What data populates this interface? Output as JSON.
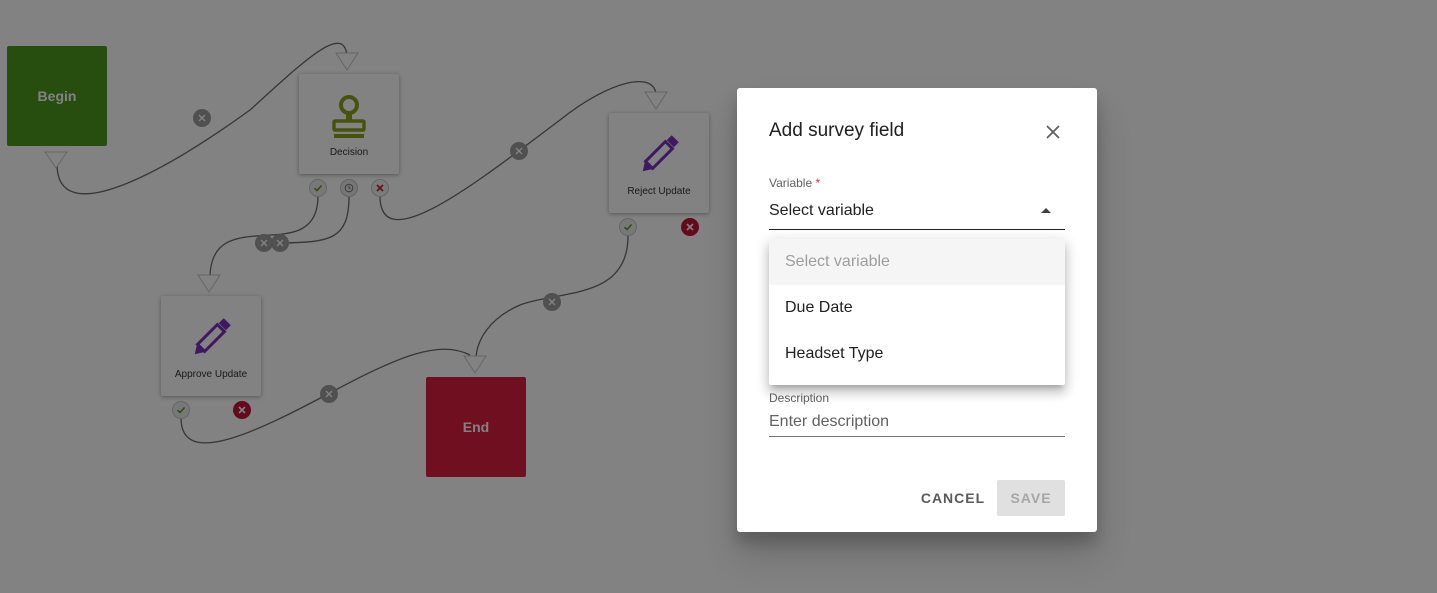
{
  "workflow": {
    "nodes": {
      "begin": {
        "label": "Begin"
      },
      "decision": {
        "label": "Decision",
        "icon": "stamp-icon",
        "icon_color": "#8ca31a"
      },
      "reject": {
        "label": "Reject Update",
        "icon": "pencil-icon",
        "icon_color": "#7b2fbe"
      },
      "approve": {
        "label": "Approve Update",
        "icon": "pencil-icon",
        "icon_color": "#7b2fbe"
      },
      "end": {
        "label": "End"
      }
    },
    "colors": {
      "begin": "#4d9a1f",
      "end": "#dc1f3e",
      "port_error": "#c4143a",
      "connector": "#6b6b6b"
    }
  },
  "dialog": {
    "title": "Add survey field",
    "variable": {
      "label": "Variable",
      "required_marker": "*",
      "value": "Select variable"
    },
    "description": {
      "label": "Description",
      "placeholder": "Enter description"
    },
    "buttons": {
      "cancel": "CANCEL",
      "save": "SAVE"
    },
    "menu": [
      "Select variable",
      "Due Date",
      "Headset Type"
    ]
  }
}
